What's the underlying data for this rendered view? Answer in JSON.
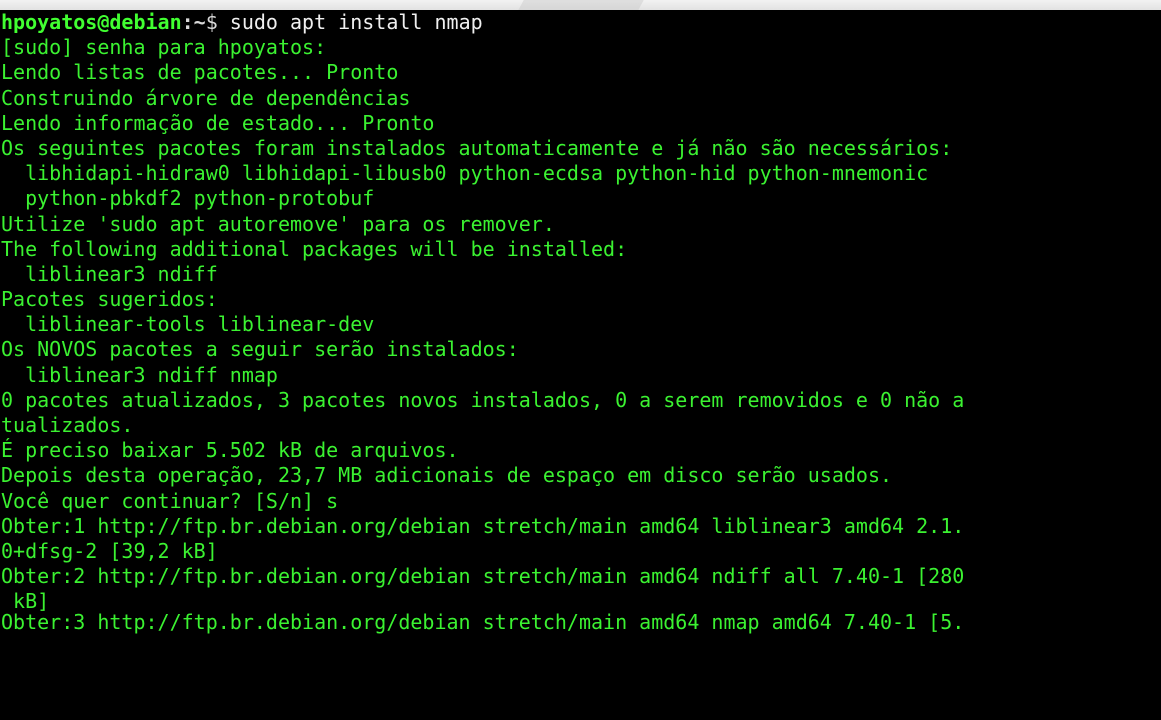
{
  "terminal": {
    "prompt": {
      "user_host": "hpoyatos@debian",
      "path": ":~",
      "symbol": "$",
      "command": " sudo apt install nmap"
    },
    "lines": [
      "[sudo] senha para hpoyatos:",
      "Lendo listas de pacotes... Pronto",
      "Construindo árvore de dependências",
      "Lendo informação de estado... Pronto",
      "Os seguintes pacotes foram instalados automaticamente e já não são necessários:",
      "  libhidapi-hidraw0 libhidapi-libusb0 python-ecdsa python-hid python-mnemonic",
      "  python-pbkdf2 python-protobuf",
      "Utilize 'sudo apt autoremove' para os remover.",
      "The following additional packages will be installed:",
      "  liblinear3 ndiff",
      "Pacotes sugeridos:",
      "  liblinear-tools liblinear-dev",
      "Os NOVOS pacotes a seguir serão instalados:",
      "  liblinear3 ndiff nmap",
      "0 pacotes atualizados, 3 pacotes novos instalados, 0 a serem removidos e 0 não a",
      "tualizados.",
      "É preciso baixar 5.502 kB de arquivos.",
      "Depois desta operação, 23,7 MB adicionais de espaço em disco serão usados.",
      "Você quer continuar? [S/n] s",
      "Obter:1 http://ftp.br.debian.org/debian stretch/main amd64 liblinear3 amd64 2.1.",
      "0+dfsg-2 [39,2 kB]",
      "Obter:2 http://ftp.br.debian.org/debian stretch/main amd64 ndiff all 7.40-1 [280",
      " kB]",
      "Obter:3 http://ftp.br.debian.org/debian stretch/main amd64 nmap amd64 7.40-1 [5."
    ]
  },
  "colors": {
    "background": "#000000",
    "output_text": "#3bf231",
    "prompt_user": "#41ff31",
    "prompt_symbol": "#d8d8d8"
  }
}
